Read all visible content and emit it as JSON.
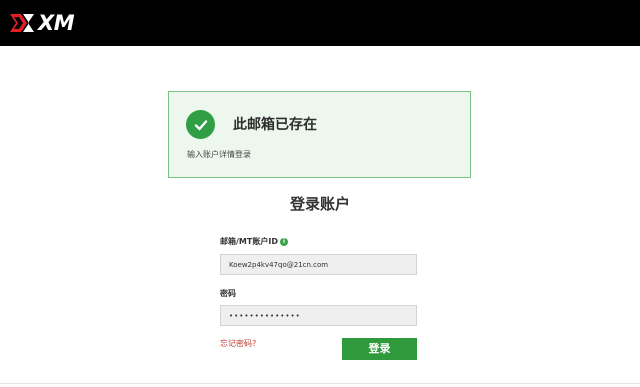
{
  "brand": {
    "logo_text": "XM",
    "accent": "#e31e26"
  },
  "notice": {
    "icon": "check-circle-icon",
    "title": "此邮箱已存在",
    "subtitle": "输入账户详情登录",
    "color": "#2f9e44"
  },
  "form": {
    "title": "登录账户",
    "email_label": "邮箱/MT账户ID",
    "email_value": "Koew2p4kv47qo@21cn.com",
    "password_label": "密码",
    "password_value": "••••••••••••••",
    "forgot_link": "忘记密码?",
    "login_button": "登录"
  }
}
